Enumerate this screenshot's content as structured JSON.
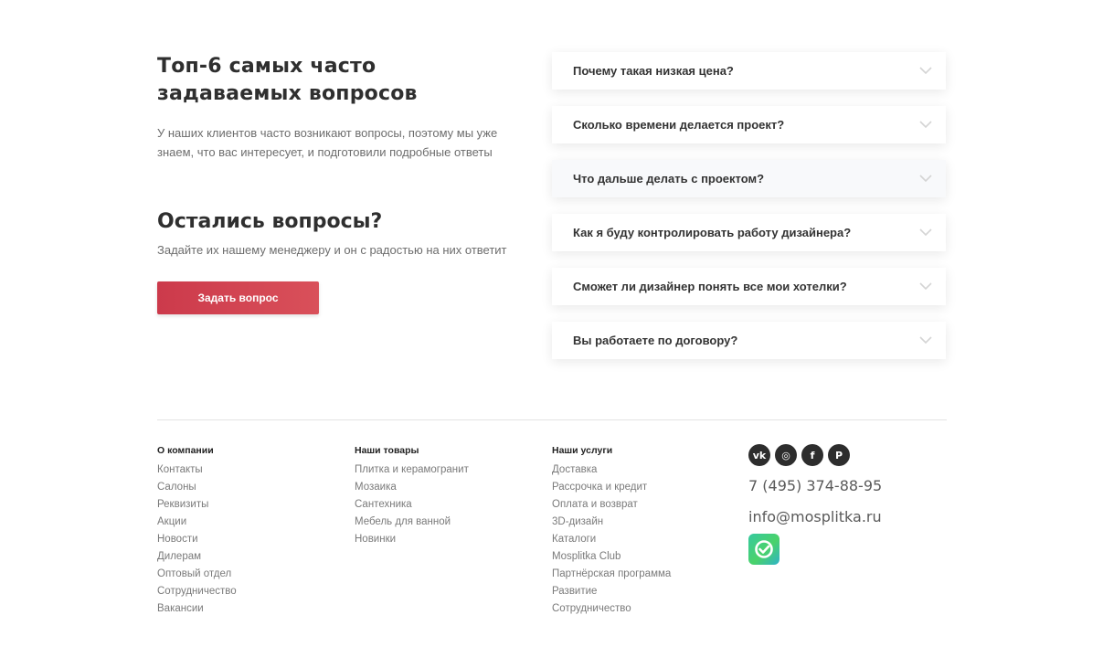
{
  "faq_intro": {
    "title_line1": "Топ-6 самых часто",
    "title_line2": "задаваемых вопросов",
    "description": "У наших клиентов часто возникают вопросы, поэтому мы уже знаем, что вас интересует, и подготовили подробные ответы"
  },
  "questions_block": {
    "title": "Остались вопросы?",
    "subtitle": "Задайте их нашему менеджеру и он с радостью на них ответит",
    "button_label": "Задать вопрос",
    "button_color": "#cc3a4b"
  },
  "faq_items": [
    "Почему такая низкая цена?",
    "Сколько времени делается проект?",
    "Что дальше делать с проектом?",
    "Как я буду контролировать работу дизайнера?",
    "Сможет ли дизайнер понять все мои хотелки?",
    "Вы работаете по договору?"
  ],
  "faq_icon": "chevron-down-icon",
  "footer": {
    "company": {
      "heading": "О компании",
      "links": [
        "Контакты",
        "Салоны",
        "Реквизиты",
        "Акции",
        "Новости",
        "Дилерам",
        "Оптовый отдел",
        "Сотрудничество",
        "Вакансии"
      ]
    },
    "products": {
      "heading": "Наши товары",
      "links": [
        "Плитка и керамогранит",
        "Мозаика",
        "Сантехника",
        "Мебель для ванной",
        "Новинки"
      ]
    },
    "services": {
      "heading": "Наши услуги",
      "links": [
        "Доставка",
        "Рассрочка и кредит",
        "Оплата и возврат",
        "3D-дизайн",
        "Каталоги",
        "Mosplitka Club",
        "Партнёрская программа",
        "Развитие",
        "Сотрудничество"
      ]
    },
    "contacts": {
      "socials": [
        {
          "icon": "vk-icon",
          "glyph": "vk"
        },
        {
          "icon": "instagram-icon",
          "glyph": "◎"
        },
        {
          "icon": "facebook-icon",
          "glyph": "f"
        },
        {
          "icon": "pinterest-icon",
          "glyph": "P"
        }
      ],
      "phone": "7 (495) 374-88-95",
      "email": "info@mosplitka.ru",
      "badge_icon": "checkmark-badge-icon"
    }
  }
}
